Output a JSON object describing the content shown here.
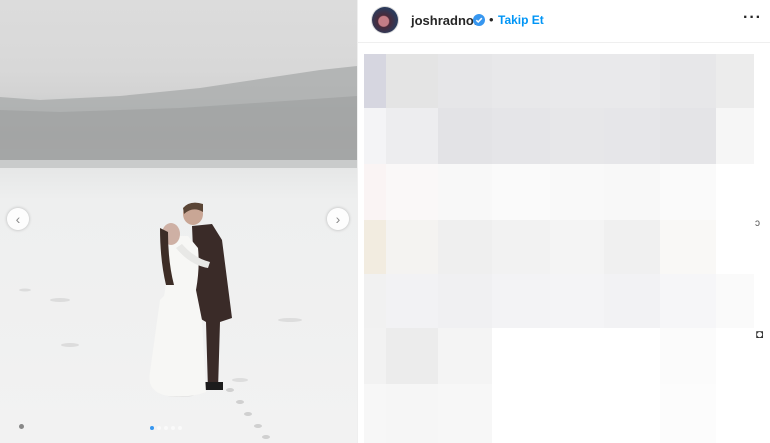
{
  "post": {
    "username": "joshradnor",
    "verified": true,
    "separator": "•",
    "follow_label": "Takip Et",
    "more_label": "···"
  },
  "carousel": {
    "slide_count": 5,
    "active_slide": 1,
    "prev_glyph": "‹",
    "next_glyph": "›"
  },
  "icons": {
    "avatar": "profile-avatar",
    "verified": "verified-badge-icon",
    "prev": "chevron-left-icon",
    "next": "chevron-right-icon",
    "more": "more-options-icon"
  },
  "colors": {
    "follow": "#0095f6",
    "verified": "#3797f0",
    "text": "#262626"
  },
  "caption_area": {
    "content": "blurred"
  },
  "edge_glyphs": {
    "a": "ɔ",
    "b": "◘"
  }
}
